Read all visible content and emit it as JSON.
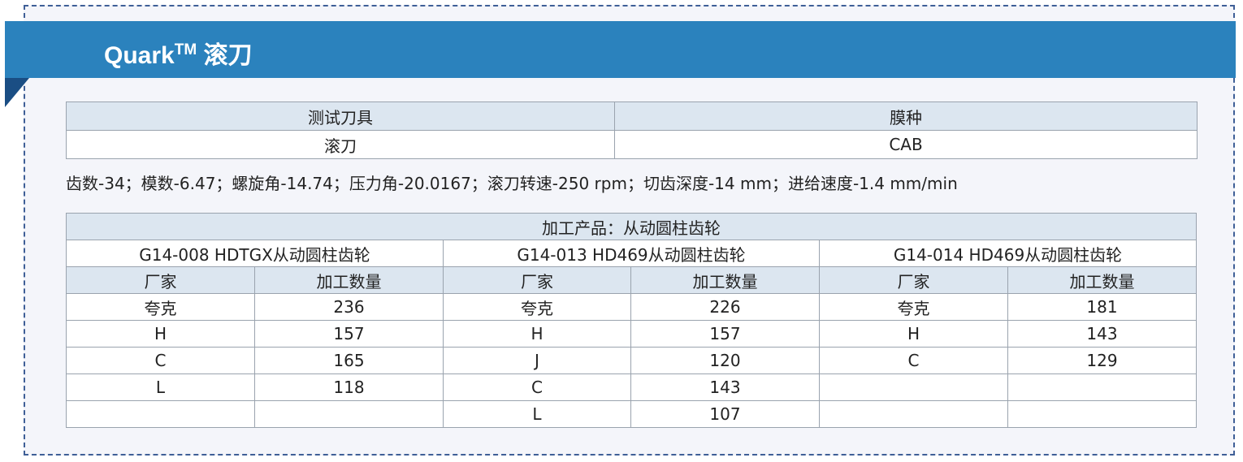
{
  "banner": {
    "title_main": "Quark",
    "title_tm": "TM",
    "title_suffix": "滚刀"
  },
  "tool_table": {
    "headers": [
      "测试刀具",
      "膜种"
    ],
    "row": [
      "滚刀",
      "CAB"
    ]
  },
  "params_text": "齿数-34；模数-6.47；螺旋角-14.74；压力角-20.0167；滚刀转速-250 rpm；切齿深度-14 mm；进给速度-1.4 mm/min",
  "product_table": {
    "title": "加工产品：从动圆柱齿轮",
    "groups": [
      "G14-008 HDTGX从动圆柱齿轮",
      "G14-013 HD469从动圆柱齿轮",
      "G14-014 HD469从动圆柱齿轮"
    ],
    "col_headers": [
      "厂家",
      "加工数量"
    ],
    "rows": [
      [
        "夸克",
        "236",
        "夸克",
        "226",
        "夸克",
        "181"
      ],
      [
        "H",
        "157",
        "H",
        "157",
        "H",
        "143"
      ],
      [
        "C",
        "165",
        "J",
        "120",
        "C",
        "129"
      ],
      [
        "L",
        "118",
        "C",
        "143",
        "",
        ""
      ],
      [
        "",
        "",
        "L",
        "107",
        "",
        ""
      ]
    ]
  }
}
